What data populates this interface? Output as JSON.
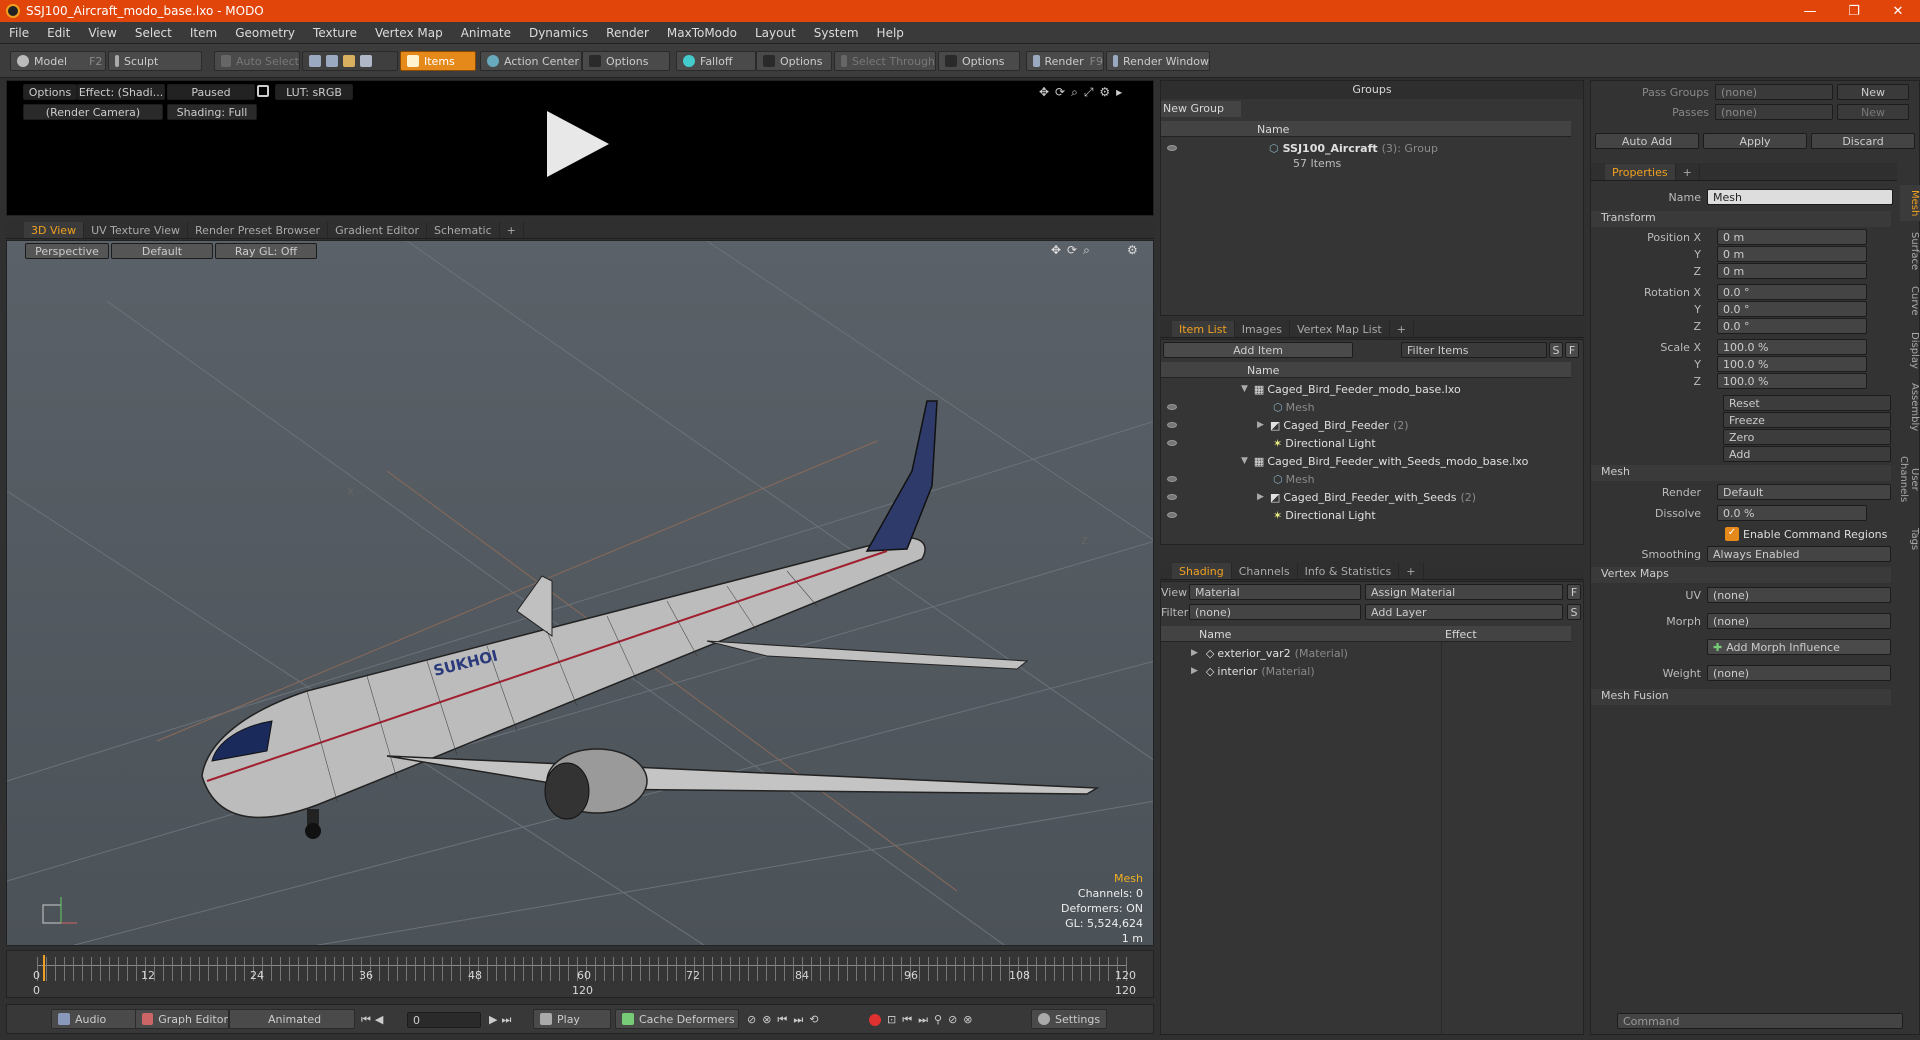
{
  "window": {
    "title": "SSJ100_Aircraft_modo_base.lxo - MODO",
    "minimize": "—",
    "restore": "❐",
    "close": "✕"
  },
  "menu": [
    "File",
    "Edit",
    "View",
    "Select",
    "Item",
    "Geometry",
    "Texture",
    "Vertex Map",
    "Animate",
    "Dynamics",
    "Render",
    "MaxToModo",
    "Layout",
    "System",
    "Help"
  ],
  "toolbar": {
    "model": "Model",
    "model_key": "F2",
    "sculpt": "Sculpt",
    "auto_select": "Auto Select",
    "items": "Items",
    "action_center": "Action Center",
    "options1": "Options",
    "falloff": "Falloff",
    "options2": "Options",
    "select_through": "Select Through",
    "options3": "Options",
    "render": "Render",
    "render_key": "F9",
    "render_window": "Render Window"
  },
  "preview": {
    "options": "Options",
    "effect": "Effect: (Shadi...",
    "paused": "Paused",
    "lut": "LUT: sRGB",
    "camera": "(Render Camera)",
    "shading": "Shading: Full"
  },
  "viewport_tabs": [
    "3D View",
    "UV Texture View",
    "Render Preset Browser",
    "Gradient Editor",
    "Schematic",
    "+"
  ],
  "viewport": {
    "perspective": "Perspective",
    "default": "Default",
    "raygl": "Ray GL: Off",
    "hud_title": "Mesh",
    "hud_channels": "Channels: 0",
    "hud_deformers": "Deformers: ON",
    "hud_gl": "GL: 5,524,624",
    "hud_scale": "1 m",
    "axis_x": "X",
    "axis_z": "Z",
    "brand": "SUKHOI"
  },
  "timeline": {
    "ticks": [
      "0",
      "12",
      "24",
      "36",
      "48",
      "60",
      "72",
      "84",
      "96",
      "108",
      "120"
    ],
    "bottom_ticks": [
      "0",
      "120",
      "120"
    ]
  },
  "transport": {
    "audio": "Audio",
    "graph_editor": "Graph Editor",
    "animated": "Animated",
    "frame": "0",
    "play": "Play",
    "cache_deformers": "Cache Deformers",
    "settings": "Settings"
  },
  "groups": {
    "title": "Groups",
    "new_group": "New Group",
    "col_name": "Name",
    "item_name": "SSJ100_Aircraft",
    "item_count": "(3)",
    "item_type": ": Group",
    "item_sub": "57 Items"
  },
  "itemlist": {
    "tabs": [
      "Item List",
      "Images",
      "Vertex Map List",
      "+"
    ],
    "add_item": "Add Item",
    "filter": "Filter Items",
    "s": "S",
    "f": "F",
    "col_name": "Name",
    "rows": [
      {
        "indent": 0,
        "label": "Caged_Bird_Feeder_modo_base.lxo",
        "sub": "",
        "dim": false
      },
      {
        "indent": 2,
        "label": "Mesh",
        "sub": "",
        "dim": true
      },
      {
        "indent": 1,
        "label": "Caged_Bird_Feeder",
        "sub": "(2)",
        "dim": false
      },
      {
        "indent": 1,
        "label": "Directional Light",
        "sub": "",
        "dim": false
      },
      {
        "indent": 0,
        "label": "Caged_Bird_Feeder_with_Seeds_modo_base.lxo",
        "sub": "",
        "dim": false
      },
      {
        "indent": 2,
        "label": "Mesh",
        "sub": "",
        "dim": true
      },
      {
        "indent": 1,
        "label": "Caged_Bird_Feeder_with_Seeds",
        "sub": "(2)",
        "dim": false
      },
      {
        "indent": 1,
        "label": "Directional Light",
        "sub": "",
        "dim": false
      }
    ]
  },
  "shading": {
    "tabs": [
      "Shading",
      "Channels",
      "Info & Statistics",
      "+"
    ],
    "view_label": "View",
    "view_value": "Material",
    "assign": "Assign Material",
    "f": "F",
    "filter_label": "Filter",
    "filter_value": "(none)",
    "add_layer": "Add Layer",
    "s": "S",
    "col_name": "Name",
    "col_effect": "Effect",
    "rows": [
      {
        "label": "exterior_var2",
        "sub": "(Material)"
      },
      {
        "label": "interior",
        "sub": "(Material)"
      }
    ]
  },
  "right": {
    "pass_groups": "Pass Groups",
    "passes": "Passes",
    "none": "(none)",
    "new": "New",
    "auto_add": "Auto Add",
    "apply": "Apply",
    "discard": "Discard",
    "properties": "Properties",
    "plus": "+",
    "name_label": "Name",
    "name_value": "Mesh",
    "transform": "Transform",
    "pos_label": "Position X",
    "rot_label": "Rotation X",
    "scale_label": "Scale X",
    "y": "Y",
    "z": "Z",
    "pos": [
      "0 m",
      "0 m",
      "0 m"
    ],
    "rot": [
      "0.0 °",
      "0.0 °",
      "0.0 °"
    ],
    "scale": [
      "100.0 %",
      "100.0 %",
      "100.0 %"
    ],
    "reset": "Reset",
    "freeze": "Freeze",
    "zero": "Zero",
    "add": "Add",
    "mesh": "Mesh",
    "render_label": "Render",
    "render_value": "Default",
    "dissolve_label": "Dissolve",
    "dissolve_value": "0.0 %",
    "enable_cmd": "Enable Command Regions",
    "smoothing_label": "Smoothing",
    "smoothing_value": "Always Enabled",
    "vertex_maps": "Vertex Maps",
    "uv_label": "UV",
    "uv_value": "(none)",
    "morph_label": "Morph",
    "morph_value": "(none)",
    "add_morph": "Add Morph Influence",
    "weight_label": "Weight",
    "weight_value": "(none)",
    "mesh_fusion": "Mesh Fusion",
    "vtabs": [
      "Mesh",
      "Surface",
      "Curve",
      "Display",
      "Assembly",
      "User Channels",
      "Tags"
    ],
    "command": "Command"
  }
}
